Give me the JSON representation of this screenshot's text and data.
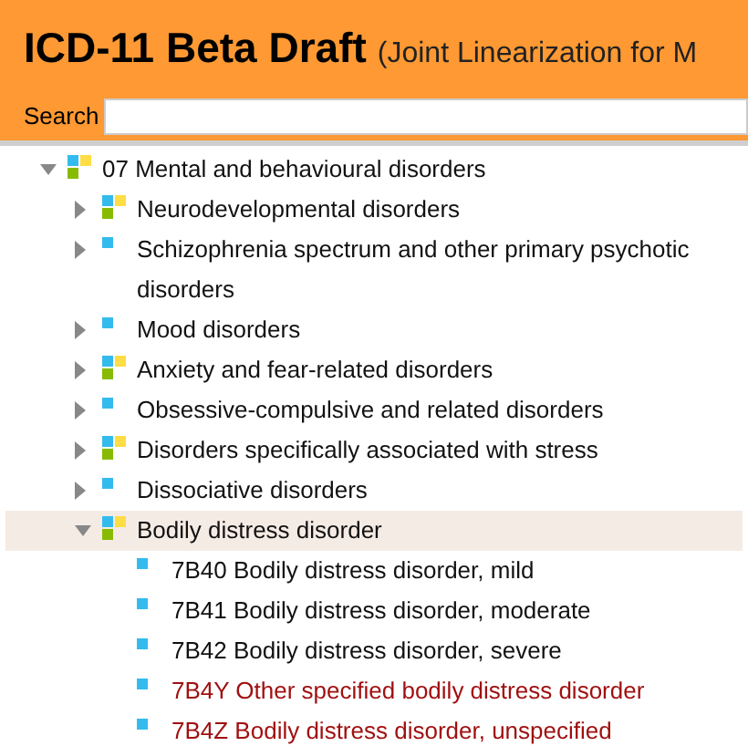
{
  "header": {
    "title": "ICD-11 Beta Draft",
    "subtitle": "(Joint Linearization for M",
    "search_label": "Search"
  },
  "tree": [
    {
      "label": "07 Mental and behavioural disorders",
      "kind": "multi",
      "expanded": true,
      "selected": false,
      "residual": false,
      "children": [
        {
          "label": "Neurodevelopmental disorders",
          "kind": "multi",
          "expanded": false,
          "selected": false,
          "residual": false
        },
        {
          "label": "Schizophrenia spectrum and other primary psychotic disorders",
          "kind": "single",
          "expanded": false,
          "selected": false,
          "residual": false
        },
        {
          "label": "Mood disorders",
          "kind": "single",
          "expanded": false,
          "selected": false,
          "residual": false
        },
        {
          "label": "Anxiety and fear-related disorders",
          "kind": "multi",
          "expanded": false,
          "selected": false,
          "residual": false
        },
        {
          "label": "Obsessive-compulsive and related disorders",
          "kind": "single",
          "expanded": false,
          "selected": false,
          "residual": false
        },
        {
          "label": "Disorders specifically associated with stress",
          "kind": "multi",
          "expanded": false,
          "selected": false,
          "residual": false
        },
        {
          "label": "Dissociative disorders",
          "kind": "single",
          "expanded": false,
          "selected": false,
          "residual": false
        },
        {
          "label": "Bodily distress disorder",
          "kind": "multi",
          "expanded": true,
          "selected": true,
          "residual": false,
          "children": [
            {
              "label": "7B40 Bodily distress disorder, mild",
              "kind": "single",
              "selected": false,
              "residual": false
            },
            {
              "label": "7B41 Bodily distress disorder, moderate",
              "kind": "single",
              "selected": false,
              "residual": false
            },
            {
              "label": "7B42 Bodily distress disorder, severe",
              "kind": "single",
              "selected": false,
              "residual": false
            },
            {
              "label": "7B4Y Other specified bodily distress disorder",
              "kind": "single",
              "selected": false,
              "residual": true
            },
            {
              "label": "7B4Z Bodily distress disorder, unspecified",
              "kind": "single",
              "selected": false,
              "residual": true
            }
          ]
        }
      ]
    }
  ]
}
